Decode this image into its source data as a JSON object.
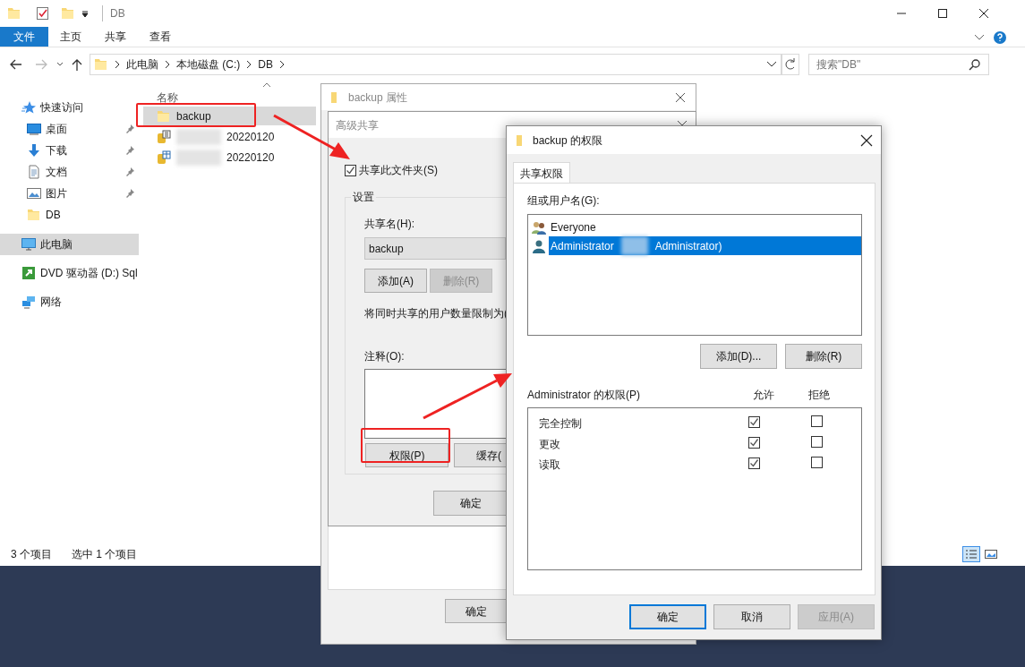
{
  "explorer": {
    "title": "DB",
    "ribbon_tabs": [
      {
        "label": "文件",
        "selected": true
      },
      {
        "label": "主页",
        "selected": false
      },
      {
        "label": "共享",
        "selected": false
      },
      {
        "label": "查看",
        "selected": false
      }
    ],
    "address_path": [
      "此电脑",
      "本地磁盘 (C:)",
      "DB"
    ],
    "search": {
      "placeholder": "搜索\"DB\""
    },
    "nav_items": [
      {
        "label": "快速访问",
        "kind": "star",
        "selected": false,
        "children": [
          {
            "label": "桌面",
            "kind": "desktop",
            "pinned": true
          },
          {
            "label": "下载",
            "kind": "download",
            "pinned": true
          },
          {
            "label": "文档",
            "kind": "document",
            "pinned": true
          },
          {
            "label": "图片",
            "kind": "pictures",
            "pinned": true
          },
          {
            "label": "DB",
            "kind": "folder",
            "pinned": false
          }
        ]
      },
      {
        "label": "此电脑",
        "kind": "computer",
        "selected": true
      },
      {
        "label": "DVD 驱动器 (D:) Sql",
        "kind": "dvd",
        "selected": false
      },
      {
        "label": "网络",
        "kind": "network",
        "selected": false
      }
    ],
    "column_header": "名称",
    "files": [
      {
        "name": "backup",
        "kind": "folder",
        "selected": true,
        "redacted": false
      },
      {
        "name": "20220120",
        "kind": "database",
        "selected": false,
        "redacted": true
      },
      {
        "name": "20220120",
        "kind": "table",
        "selected": false,
        "redacted": true
      }
    ],
    "status_bar": [
      "3 个项目",
      "选中 1 个项目"
    ]
  },
  "properties_dialog": {
    "title": "backup 属性",
    "ok": "确定"
  },
  "advanced_sharing_dialog": {
    "title": "高级共享",
    "share_checkbox": {
      "label": "共享此文件夹(S)",
      "checked": true
    },
    "group_title": "设置",
    "share_name_label": "共享名(H):",
    "share_name": "backup",
    "buttons": [
      {
        "label": "添加(A)",
        "disabled": false
      },
      {
        "label": "删除(R)",
        "disabled": true
      }
    ],
    "limit_text": "将同时共享的用户数量限制为(",
    "comment_label": "注释(O):",
    "permissions_button": "权限(P)",
    "cache_button": "缓存(",
    "ok": "确定"
  },
  "permissions_dialog": {
    "title": "backup 的权限",
    "tabs": [
      {
        "label": "共享权限",
        "selected": true
      }
    ],
    "principals_label": "组或用户名(G):",
    "principals": [
      {
        "name": "Everyone",
        "kind": "group",
        "selected": false,
        "redacted": false
      },
      {
        "name": "Administrator",
        "suffix": "Administrator)",
        "kind": "user",
        "selected": true,
        "redacted": true
      }
    ],
    "principal_buttons": [
      "添加(D)...",
      "删除(R)"
    ],
    "permissions_label": "Administrator 的权限(P)",
    "allow_header": "允许",
    "deny_header": "拒绝",
    "permissions": [
      {
        "name": "完全控制",
        "allow": true,
        "deny": false
      },
      {
        "name": "更改",
        "allow": true,
        "deny": false
      },
      {
        "name": "读取",
        "allow": true,
        "deny": false
      }
    ],
    "buttons": [
      {
        "label": "确定",
        "kind": "default",
        "disabled": false
      },
      {
        "label": "取消",
        "kind": "normal",
        "disabled": false
      },
      {
        "label": "应用(A)",
        "kind": "normal",
        "disabled": true
      }
    ]
  }
}
